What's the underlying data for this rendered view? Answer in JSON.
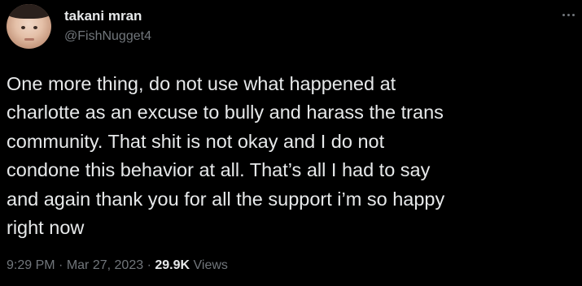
{
  "author": {
    "display_name": "takani mran",
    "handle": "@FishNugget4"
  },
  "menu": {
    "icon": "more-horizontal-icon"
  },
  "tweet": {
    "lines": [
      "One more thing, do not use what happened at",
      "charlotte as an excuse to bully and harass the trans",
      "community. That shit is not okay and I do not",
      "condone this behavior at all. That’s all I had to say",
      "and again thank you for all the support i’m so happy",
      "right now"
    ]
  },
  "meta": {
    "time": "9:29 PM",
    "separator": "·",
    "date": "Mar 27, 2023",
    "views_count": "29.9K",
    "views_label": "Views"
  },
  "colors": {
    "background": "#000000",
    "primary_text": "#e7e9ea",
    "secondary_text": "#71767b"
  }
}
